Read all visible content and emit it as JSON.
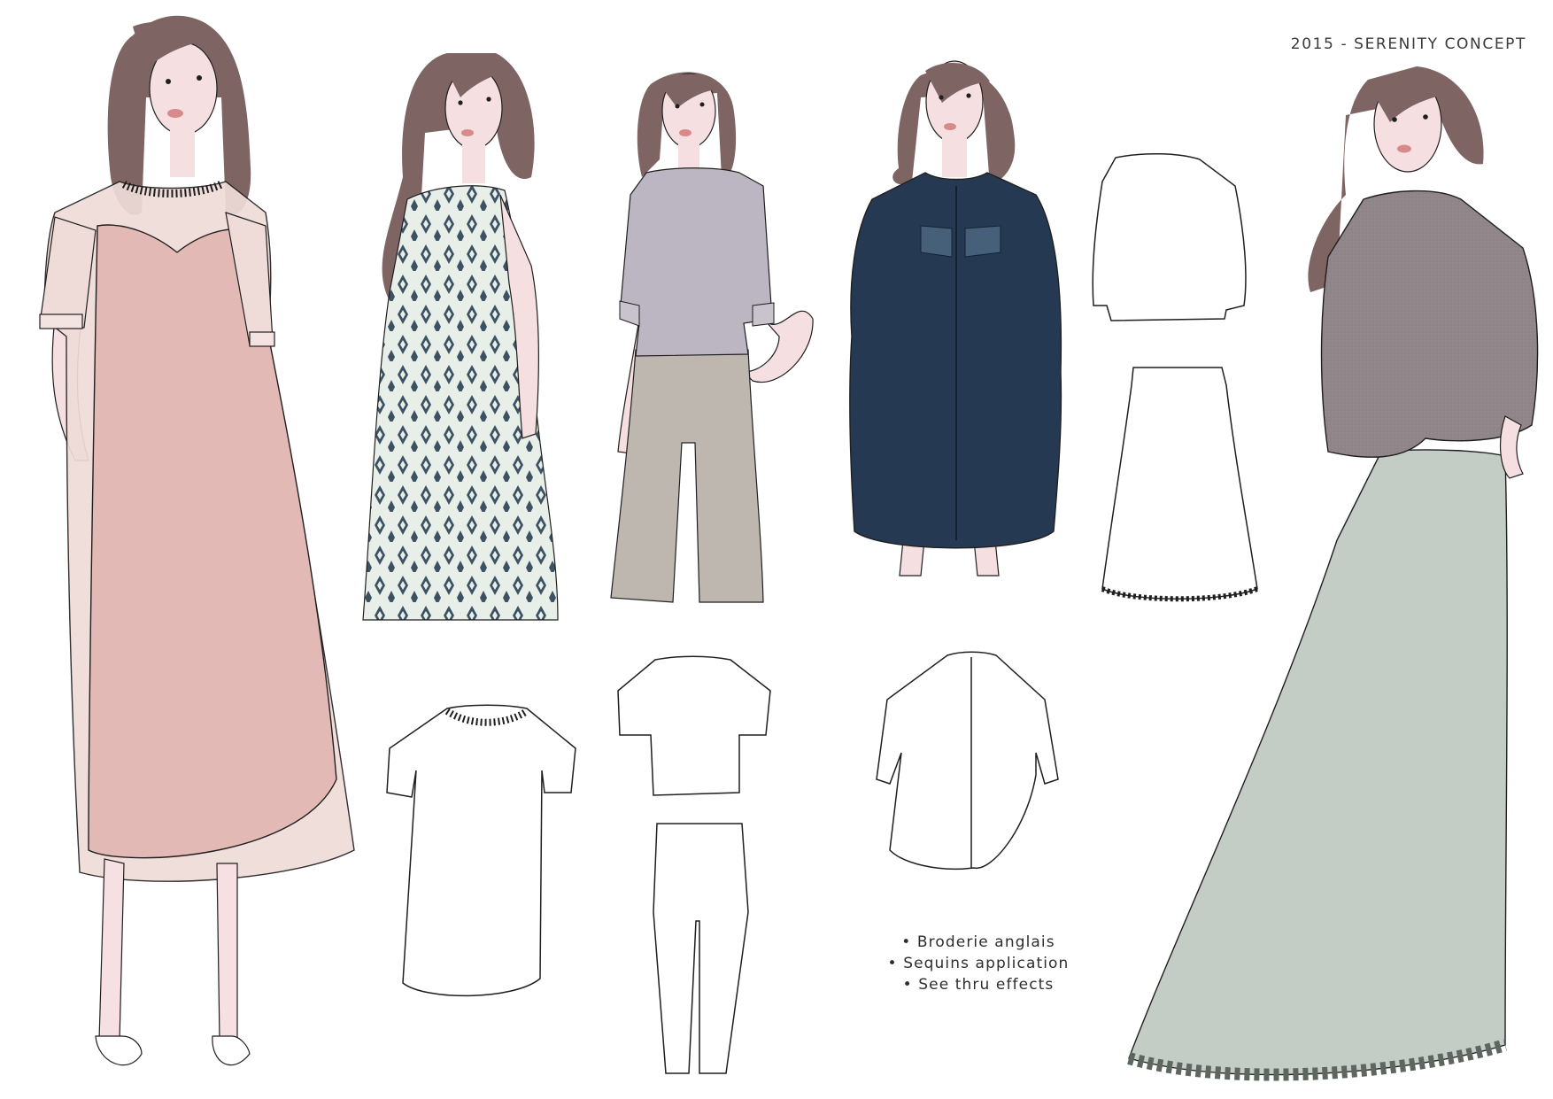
{
  "board": {
    "title": "2015 - SERENITY CONCEPT",
    "details": [
      "Broderie anglais",
      "Sequins application",
      "See thru effects"
    ]
  },
  "colors": {
    "hair": "#7e6462",
    "skin": "#f6dfe0",
    "blush_dress": "#e3b9b5",
    "sheer_layer": "#efdcd9",
    "ikat_ground": "#e8efe9",
    "ikat_motif": "#3c5263",
    "grey_top": "#bcb6c2",
    "taupe_trouser": "#bdb7b0",
    "navy_coat": "#253a52",
    "mauve_sweater": "#8f8589",
    "sage_skirt": "#c3ccc5",
    "line": "#1f1f1f"
  },
  "looks": [
    {
      "outfit": "blush slip dress with sheer embroidered overlay"
    },
    {
      "outfit": "ikat print shift dress"
    },
    {
      "outfit": "cropped tee with wide trousers"
    },
    {
      "outfit": "navy embroidered shirt dress"
    },
    {
      "outfit": "oversized sweater with lace-hem maxi skirt"
    }
  ]
}
